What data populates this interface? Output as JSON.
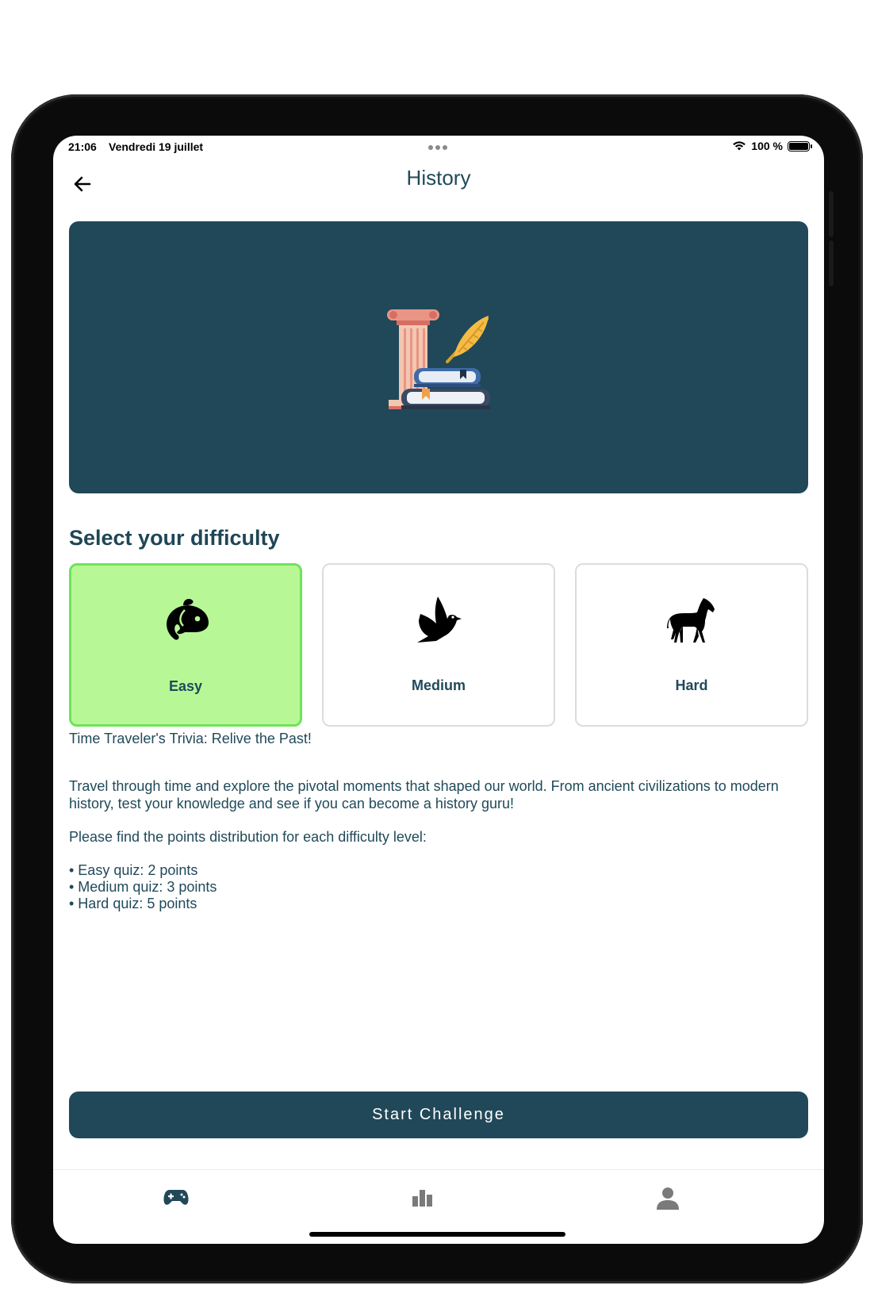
{
  "status_bar": {
    "time": "21:06",
    "date": "Vendredi 19 juillet",
    "battery": "100 %"
  },
  "header": {
    "title": "History",
    "back_icon": "arrow-left-icon"
  },
  "banner": {
    "icon": "history-column-books-quill-icon",
    "background": "#204858"
  },
  "difficulty": {
    "title": "Select your difficulty",
    "options": [
      {
        "label": "Easy",
        "icon": "fish-icon",
        "selected": true
      },
      {
        "label": "Medium",
        "icon": "dove-icon",
        "selected": false
      },
      {
        "label": "Hard",
        "icon": "horse-icon",
        "selected": false
      }
    ]
  },
  "description": {
    "headline": "Time Traveler's Trivia: Relive the Past!",
    "body_line1": "Travel through time and explore the pivotal moments that shaped our world. From ancient civilizations to modern",
    "body_line2": "history, test your knowledge and see if you can become a history guru!",
    "points_intro": "Please find the points distribution for each difficulty level:",
    "points": [
      "• Easy quiz: 2 points",
      "• Medium quiz: 3 points",
      "• Hard quiz: 5 points"
    ]
  },
  "start_button": {
    "label": "Start Challenge"
  },
  "tab_bar": {
    "tabs": [
      {
        "icon": "gamepad-icon",
        "active": true
      },
      {
        "icon": "bar-chart-icon",
        "active": false
      },
      {
        "icon": "user-icon",
        "active": false
      }
    ]
  },
  "colors": {
    "primary": "#204858",
    "selected_card": "#b8f796",
    "selected_border": "#6ee35a",
    "text": "#204a5a"
  }
}
